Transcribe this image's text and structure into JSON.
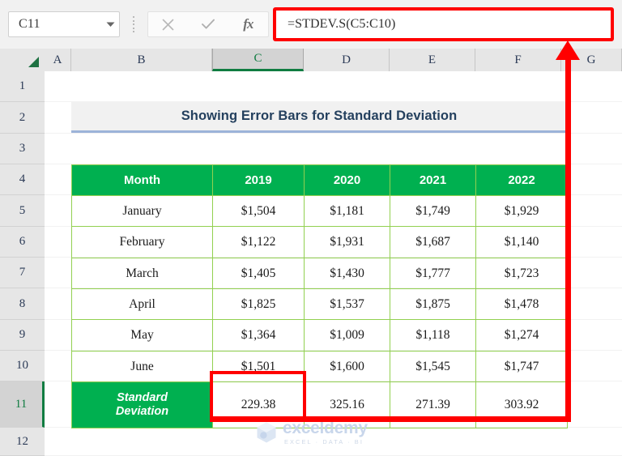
{
  "app": {
    "name_box_value": "C11",
    "formula_bar_value": "=STDEV.S(C5:C10)",
    "cancel_icon": "close-icon",
    "enter_icon": "check-icon",
    "function_icon": "fx-icon",
    "dropdown_icon": "chevron-down-icon",
    "accent_green": "#107c41",
    "annotation_color": "#ff0000"
  },
  "columns": [
    {
      "label": "A",
      "selected": false
    },
    {
      "label": "B",
      "selected": false
    },
    {
      "label": "C",
      "selected": true
    },
    {
      "label": "D",
      "selected": false
    },
    {
      "label": "E",
      "selected": false
    },
    {
      "label": "F",
      "selected": false
    },
    {
      "label": "G",
      "selected": false
    }
  ],
  "rows": [
    {
      "label": "1",
      "selected": false
    },
    {
      "label": "2",
      "selected": false
    },
    {
      "label": "3",
      "selected": false
    },
    {
      "label": "4",
      "selected": false
    },
    {
      "label": "5",
      "selected": false
    },
    {
      "label": "6",
      "selected": false
    },
    {
      "label": "7",
      "selected": false
    },
    {
      "label": "8",
      "selected": false
    },
    {
      "label": "9",
      "selected": false
    },
    {
      "label": "10",
      "selected": false
    },
    {
      "label": "11",
      "selected": true
    },
    {
      "label": "12",
      "selected": false
    }
  ],
  "sheet": {
    "title": "Showing Error Bars for Standard Deviation",
    "table": {
      "headers": [
        "Month",
        "2019",
        "2020",
        "2021",
        "2022"
      ],
      "rows": [
        {
          "month": "January",
          "y2019": "$1,504",
          "y2020": "$1,181",
          "y2021": "$1,749",
          "y2022": "$1,929"
        },
        {
          "month": "February",
          "y2019": "$1,122",
          "y2020": "$1,931",
          "y2021": "$1,687",
          "y2022": "$1,140"
        },
        {
          "month": "March",
          "y2019": "$1,405",
          "y2020": "$1,430",
          "y2021": "$1,777",
          "y2022": "$1,723"
        },
        {
          "month": "April",
          "y2019": "$1,825",
          "y2020": "$1,537",
          "y2021": "$1,875",
          "y2022": "$1,478"
        },
        {
          "month": "May",
          "y2019": "$1,364",
          "y2020": "$1,009",
          "y2021": "$1,118",
          "y2022": "$1,274"
        },
        {
          "month": "June",
          "y2019": "$1,501",
          "y2020": "$1,600",
          "y2021": "$1,545",
          "y2022": "$1,747"
        }
      ],
      "summary": {
        "label_line1": "Standard",
        "label_line2": "Deviation",
        "y2019": "229.38",
        "y2020": "325.16",
        "y2021": "271.39",
        "y2022": "303.92"
      },
      "header_fill": "#00b050",
      "border_color": "#92d050"
    }
  },
  "watermark": {
    "name": "exceldemy",
    "tagline": "EXCEL · DATA · BI"
  }
}
